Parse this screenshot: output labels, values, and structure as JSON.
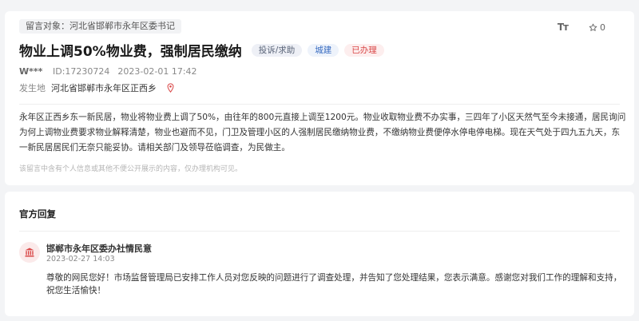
{
  "message": {
    "target_label": "留言对象：",
    "target_value": "河北省邯郸市永年区委书记",
    "title": "物业上调50%物业费，强制居民缴纳",
    "tags": {
      "type": "投诉/求助",
      "field": "城建",
      "status": "已办理"
    },
    "user": "W***",
    "id_text": "ID:17230724",
    "time": "2023-02-01 17:42",
    "location_label": "发生地",
    "location_value": "河北省邯郸市永年区正西乡",
    "content": "永年区正西乡东一新民居，物业将物业费上调了50%，由往年的800元直接上调至1200元。物业收取物业费不办实事，三四年了小区天然气至今未接通，居民询问为何上调物业费要求物业解释清楚，物业也避而不见，门卫及管理小区的人强制居民缴纳物业费，不缴纳物业费便停水停电停电梯。现在天气处于四九五九天，东一新民居居民们无奈只能妥协。请相关部门及领导莅临调查，为民做主。",
    "privacy_note": "该留言中含有个人信息或其他不便公开展示的内容，仅办理机构可见。"
  },
  "toolbar": {
    "font_size_glyph": "Tт",
    "favorite_count": "0",
    "icons": {
      "font_size": "font-size-icon",
      "favorite": "star-icon",
      "location": "location-pin-icon",
      "avatar": "government-building-icon"
    }
  },
  "reply": {
    "heading": "官方回复",
    "org_name": "邯郸市永年区委办社情民意",
    "time": "2023-02-27 14:03",
    "content": "尊敬的网民您好！市场监督管理局已安排工作人员对您反映的问题进行了调查处理，并告知了您处理结果，您表示满意。感谢您对我们工作的理解和支持，祝您生活愉快！"
  },
  "colors": {
    "accent_red": "#d94848",
    "field_blue": "#3d6fc2",
    "page_bg": "#f3f4f6"
  }
}
